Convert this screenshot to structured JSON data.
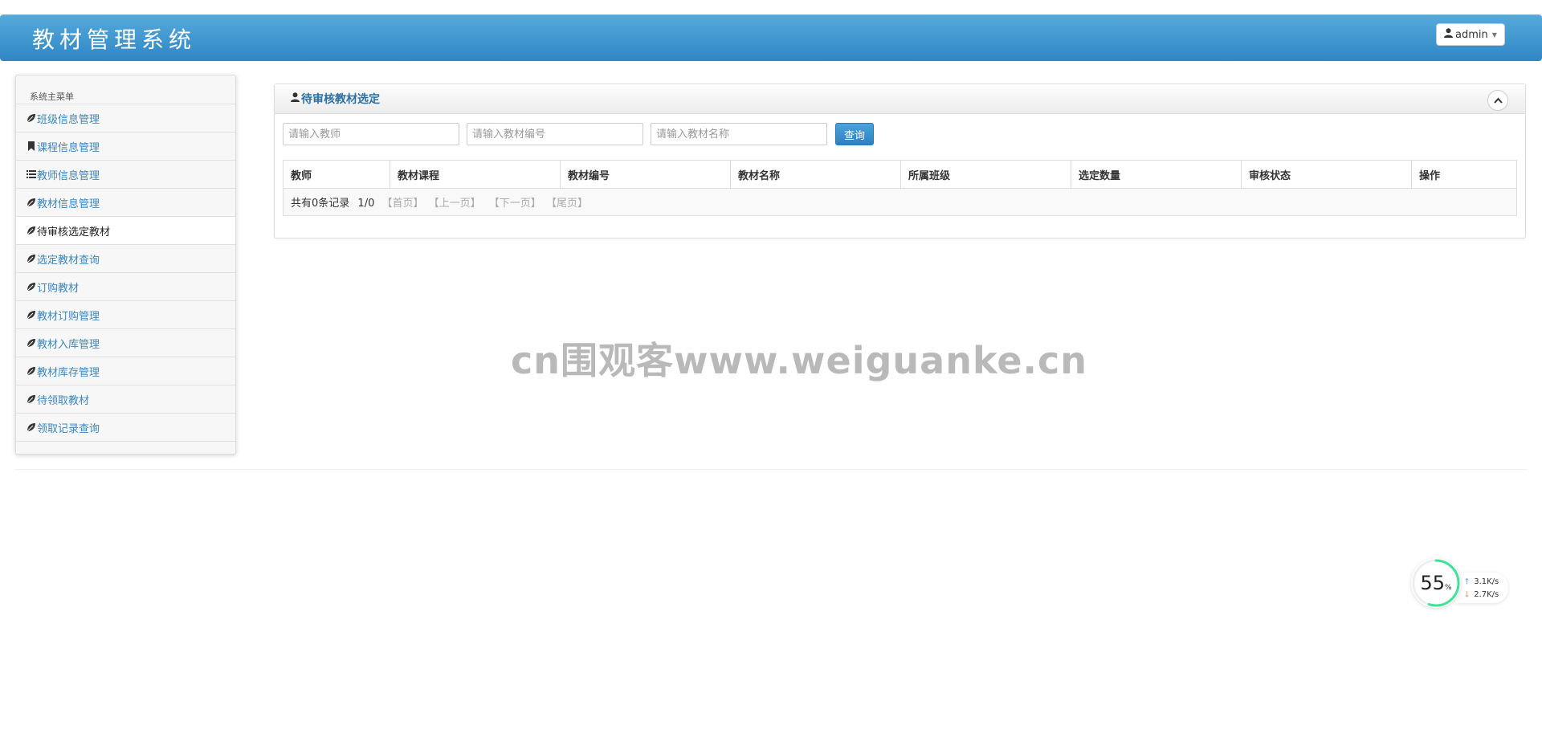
{
  "header": {
    "title": "教材管理系统",
    "user_label": "admin"
  },
  "sidebar": {
    "menu_title": "系统主菜单",
    "items": [
      {
        "label": "班级信息管理",
        "icon": "leaf-icon"
      },
      {
        "label": "课程信息管理",
        "icon": "bookmark-icon"
      },
      {
        "label": "教师信息管理",
        "icon": "list-icon"
      },
      {
        "label": "教材信息管理",
        "icon": "leaf-icon"
      },
      {
        "label": "待审核选定教材",
        "icon": "leaf-icon",
        "active": true
      },
      {
        "label": "选定教材查询",
        "icon": "leaf-icon"
      },
      {
        "label": "订购教材",
        "icon": "leaf-icon"
      },
      {
        "label": "教材订购管理",
        "icon": "leaf-icon"
      },
      {
        "label": "教材入库管理",
        "icon": "leaf-icon"
      },
      {
        "label": "教材库存管理",
        "icon": "leaf-icon"
      },
      {
        "label": "待领取教材",
        "icon": "leaf-icon"
      },
      {
        "label": "领取记录查询",
        "icon": "leaf-icon"
      }
    ]
  },
  "panel": {
    "title": "待审核教材选定",
    "search": {
      "teacher_placeholder": "请输入教师",
      "code_placeholder": "请输入教材编号",
      "name_placeholder": "请输入教材名称",
      "query_label": "查询"
    },
    "table": {
      "columns": [
        "教师",
        "教材课程",
        "教材编号",
        "教材名称",
        "所属班级",
        "选定数量",
        "审核状态",
        "操作"
      ],
      "pager": {
        "summary": "共有0条记录",
        "page": "1/0",
        "first": "【首页】",
        "prev": "【上一页】",
        "next": "【下一页】",
        "last": "【尾页】"
      }
    }
  },
  "watermark": "cn围观客www.weiguanke.cn",
  "network_widget": {
    "percent": "55",
    "percent_unit": "%",
    "percent_value": 0.55,
    "upload": "3.1K/s",
    "download": "2.7K/s"
  },
  "colors": {
    "header_blue": "#3a93cf",
    "link_blue": "#3a87c0",
    "panel_title": "#2b6fa6",
    "button_blue": "#2d80c0",
    "widget_arc": "#3ee39a"
  }
}
